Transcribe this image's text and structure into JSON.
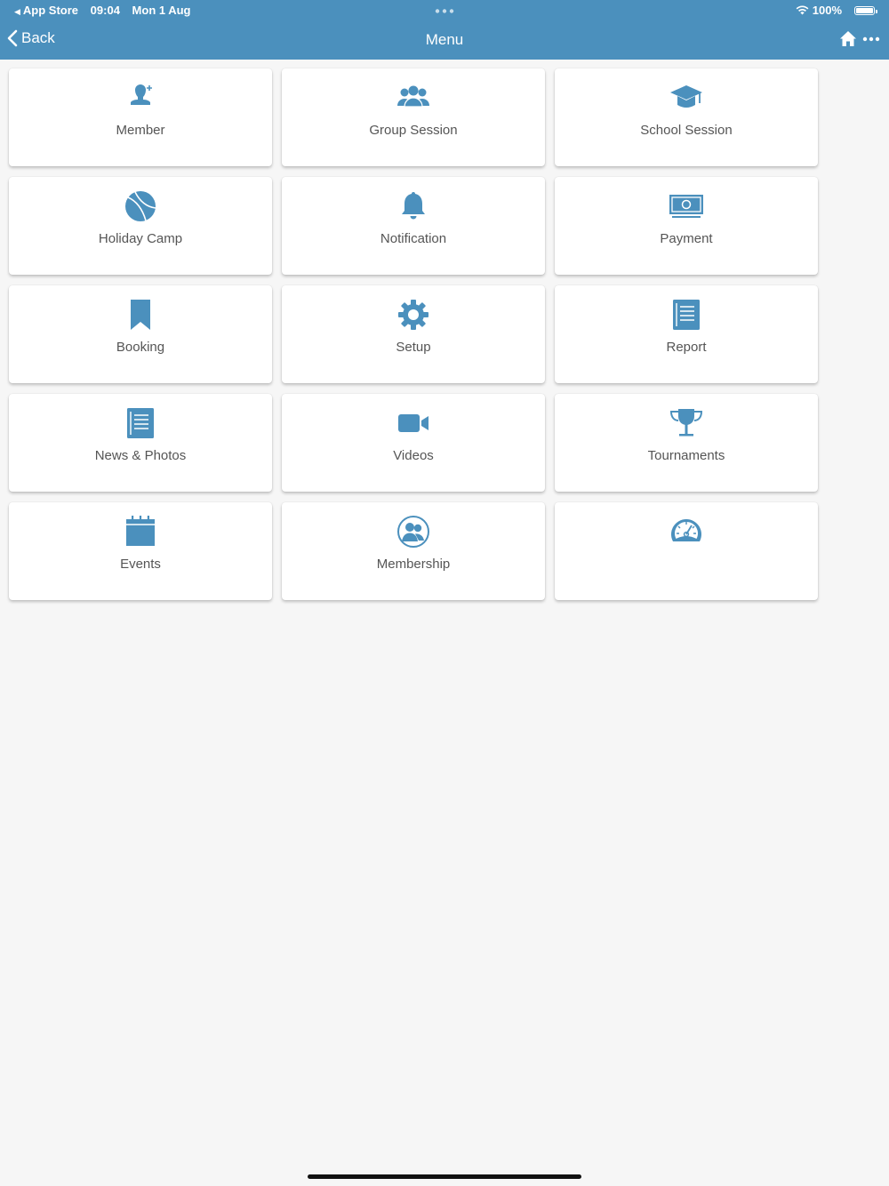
{
  "status_bar": {
    "back_app": "App Store",
    "time": "09:04",
    "date": "Mon 1 Aug",
    "battery": "100%",
    "icons": [
      "back-triangle-icon",
      "wifi-icon",
      "battery-icon"
    ]
  },
  "nav": {
    "back_label": "Back",
    "title": "Menu",
    "icons": [
      "chevron-left-icon",
      "home-icon",
      "more-icon"
    ]
  },
  "colors": {
    "accent": "#4b90bd",
    "background": "#f6f6f6",
    "tile": "#ffffff",
    "label": "#555555"
  },
  "tiles": [
    {
      "label": "Member",
      "icon": "member-icon"
    },
    {
      "label": "Group Session",
      "icon": "group-icon"
    },
    {
      "label": "School Session",
      "icon": "graduation-cap-icon"
    },
    {
      "label": "Holiday Camp",
      "icon": "ball-icon"
    },
    {
      "label": "Notification",
      "icon": "bell-icon"
    },
    {
      "label": "Payment",
      "icon": "money-icon"
    },
    {
      "label": "Booking",
      "icon": "bookmark-icon"
    },
    {
      "label": "Setup",
      "icon": "gear-icon"
    },
    {
      "label": "Report",
      "icon": "report-icon"
    },
    {
      "label": "News & Photos",
      "icon": "newspaper-icon"
    },
    {
      "label": "Videos",
      "icon": "video-camera-icon"
    },
    {
      "label": "Tournaments",
      "icon": "trophy-icon"
    },
    {
      "label": "Events",
      "icon": "calendar-icon"
    },
    {
      "label": "Membership",
      "icon": "membership-icon"
    },
    {
      "label": "",
      "icon": "dashboard-gauge-icon"
    }
  ]
}
